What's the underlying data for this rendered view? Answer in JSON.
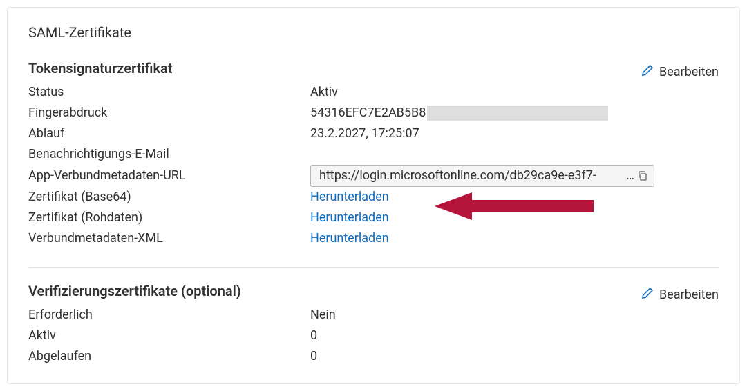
{
  "card": {
    "title": "SAML-Zertifikate"
  },
  "edit_label": "Bearbeiten",
  "signing": {
    "heading": "Tokensignaturzertifikat",
    "rows": {
      "status_label": "Status",
      "status_value": "Aktiv",
      "thumbprint_label": "Fingerabdruck",
      "thumbprint_value": "54316EFC7E2AB5B8",
      "expiry_label": "Ablauf",
      "expiry_value": "23.2.2027, 17:25:07",
      "notify_email_label": "Benachrichtigungs-E-Mail",
      "notify_email_value": "",
      "metadata_url_label": "App-Verbundmetadaten-URL",
      "metadata_url_value": "https://login.microsoftonline.com/db29ca9e-e3f7-",
      "cert_base64_label": "Zertifikat (Base64)",
      "cert_raw_label": "Zertifikat (Rohdaten)",
      "fed_xml_label": "Verbundmetadaten-XML",
      "download_label": "Herunterladen"
    }
  },
  "verification": {
    "heading": "Verifizierungszertifikate (optional)",
    "rows": {
      "required_label": "Erforderlich",
      "required_value": "Nein",
      "active_label": "Aktiv",
      "active_value": "0",
      "expired_label": "Abgelaufen",
      "expired_value": "0"
    }
  },
  "colors": {
    "link": "#0f6cbd",
    "arrow": "#B5143B",
    "edit_icon": "#0f6cbd"
  }
}
